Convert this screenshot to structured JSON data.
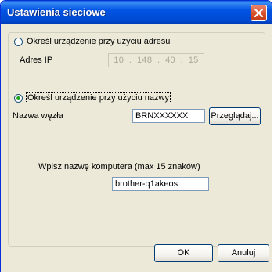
{
  "window": {
    "title": "Ustawienia sieciowe"
  },
  "options": {
    "by_address": {
      "label": "Określ urządzenie przy użyciu adresu",
      "selected": false,
      "ip_label": "Adres IP",
      "ip_octets": [
        "10",
        "148",
        "40",
        "15"
      ],
      "ip_separator": "."
    },
    "by_name": {
      "label": "Określ urządzenie przy użyciu nazwy",
      "selected": true,
      "node_label": "Nazwa węzła",
      "node_value": "BRNXXXXXX",
      "browse_label": "Przeglądaj..."
    }
  },
  "computer": {
    "label": "Wpisz nazwę komputera (max 15 znaków)",
    "value": "brother-q1akeos"
  },
  "buttons": {
    "ok": "OK",
    "cancel": "Anuluj"
  }
}
